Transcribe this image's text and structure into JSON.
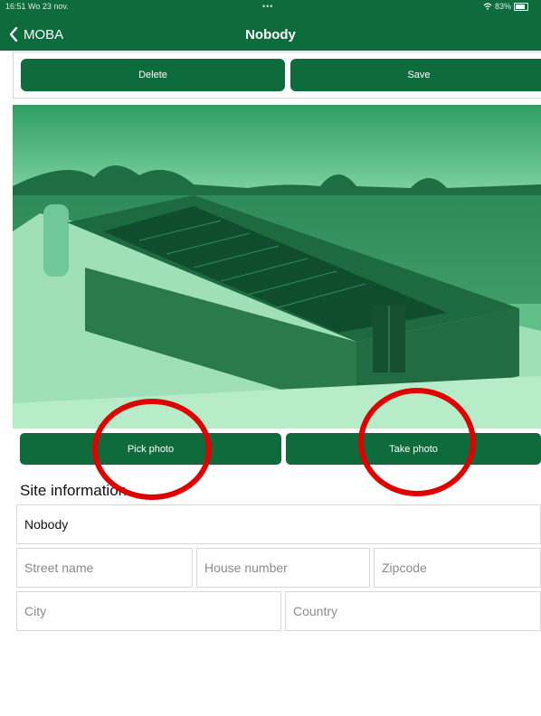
{
  "status_bar": {
    "time": "16:51  Wo 23 nov.",
    "dots": "•••",
    "battery": "83%"
  },
  "nav": {
    "back_label": "MOBA",
    "title": "Nobody"
  },
  "actions": {
    "delete_label": "Delete",
    "save_label": "Save"
  },
  "photo_buttons": {
    "pick_label": "Pick photo",
    "take_label": "Take photo"
  },
  "site_information": {
    "heading": "Site information",
    "site_name": "Nobody",
    "street_placeholder": "Street name",
    "house_number_placeholder": "House number",
    "zipcode_placeholder": "Zipcode",
    "city_placeholder": "City",
    "country_placeholder": "Country"
  },
  "colors": {
    "brand_green": "#0e6b3c",
    "annotation_red": "#e00000"
  }
}
